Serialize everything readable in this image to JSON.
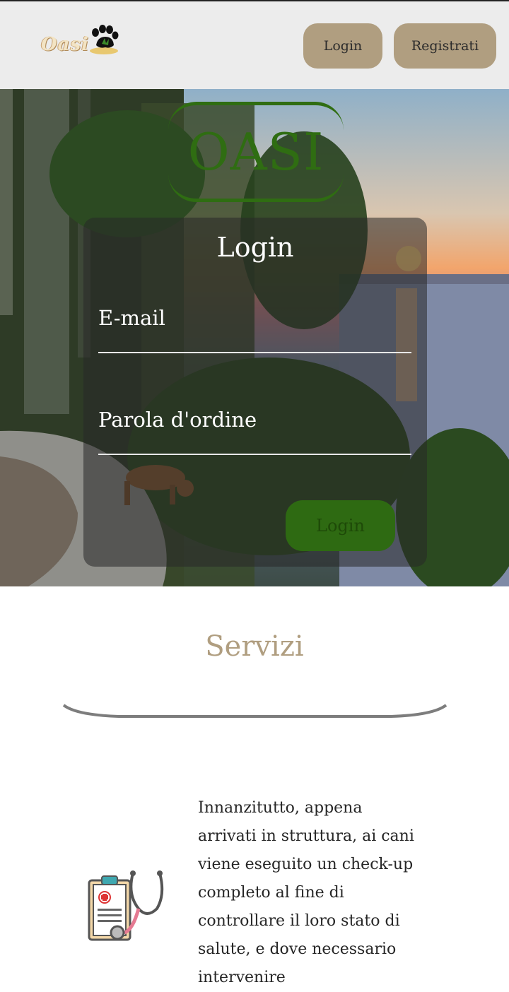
{
  "header": {
    "logo_text": "Oasi",
    "login_label": "Login",
    "register_label": "Registrati"
  },
  "hero": {
    "brand_title": "OASI",
    "login_card": {
      "title": "Login",
      "email_placeholder": "E-mail",
      "password_placeholder": "Parola d'ordine",
      "submit_label": "Login"
    }
  },
  "services": {
    "title": "Servizi",
    "items": [
      {
        "icon": "medical-checkup-icon",
        "text": "Innanzitutto, appena arrivati in struttura, ai cani viene eseguito un check-up completo al fine di controllare il loro stato di salute, e dove necessario intervenire"
      }
    ]
  },
  "colors": {
    "accent_tan": "#b09e80",
    "brand_green": "#2f6d12",
    "header_bg": "#ececec"
  }
}
